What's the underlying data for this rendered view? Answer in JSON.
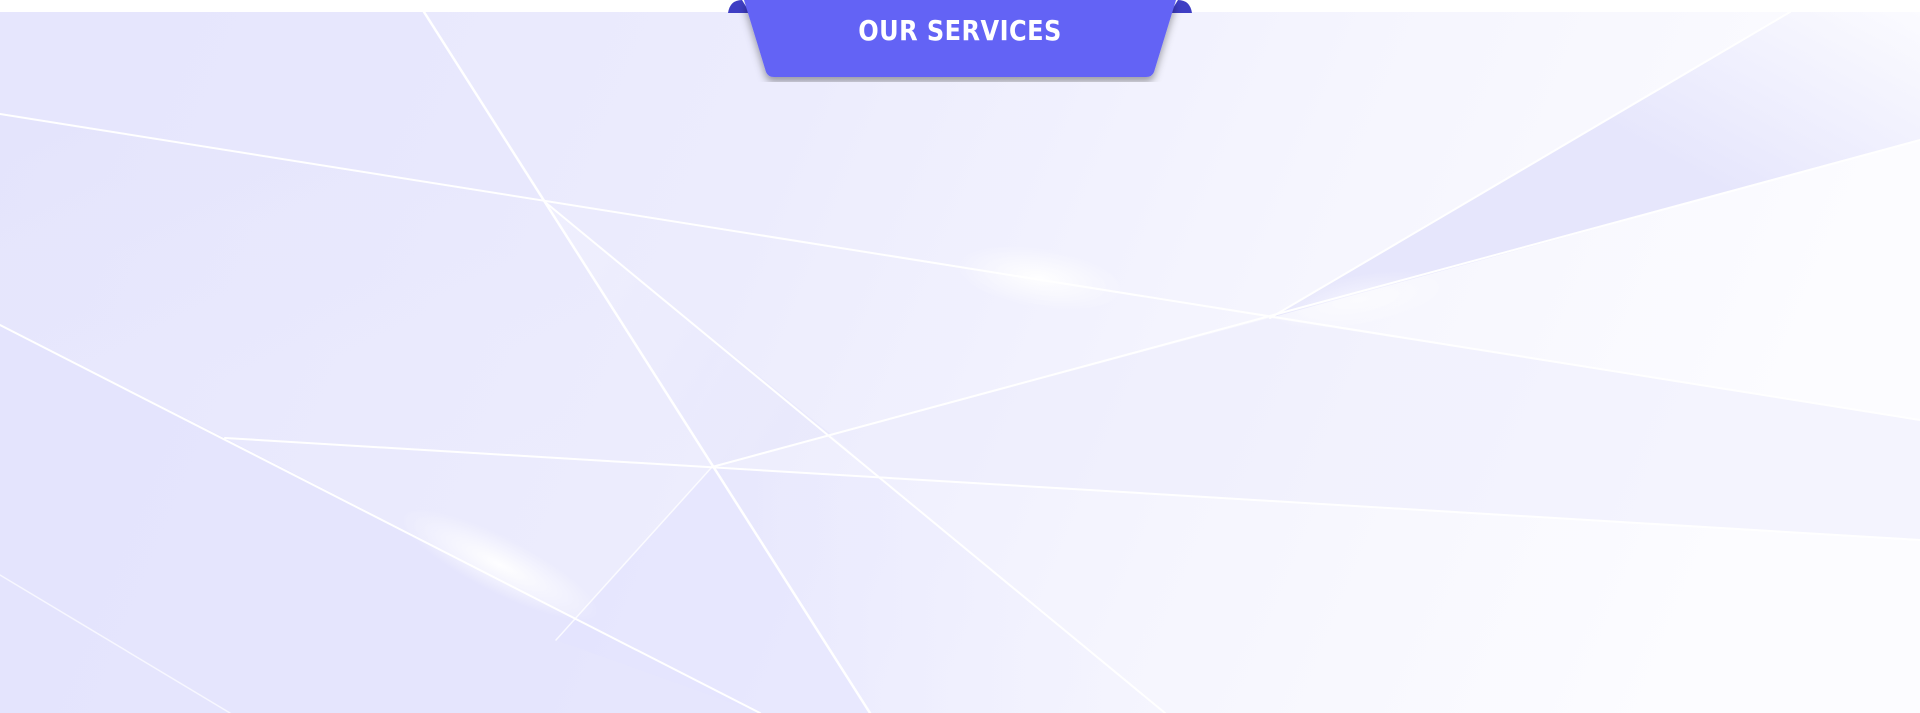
{
  "section": {
    "title": "OUR SERVICES"
  },
  "colors": {
    "ribbon": "#6463f5",
    "ribbon_fold": "#3f3ec4",
    "background_tint": "#e4e4fd",
    "background_light": "#fbfbff",
    "facet_line": "#ffffff"
  },
  "icons": {
    "background": "geometric-facets-pattern"
  }
}
